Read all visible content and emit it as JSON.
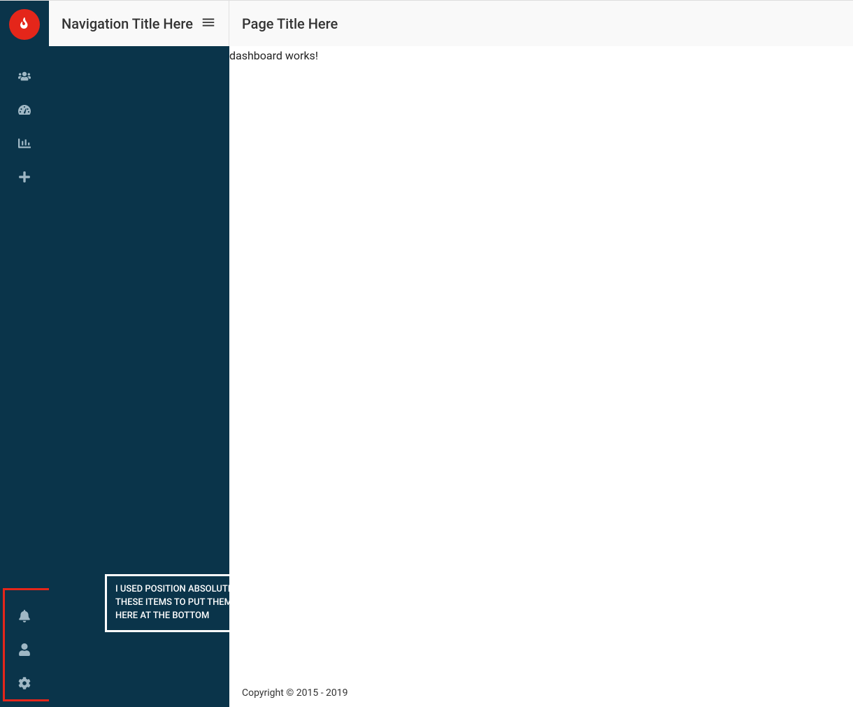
{
  "logo_icon": "fire-icon",
  "sidebar_top": [
    {
      "name": "users-icon"
    },
    {
      "name": "dashboard-icon"
    },
    {
      "name": "chart-icon"
    },
    {
      "name": "plus-icon"
    }
  ],
  "sidebar_bottom": [
    {
      "name": "bell-icon"
    },
    {
      "name": "user-icon"
    },
    {
      "name": "gear-icon"
    }
  ],
  "nav_title": "Navigation Title Here",
  "page_title": "Page Title Here",
  "body_text": "dashboard works!",
  "annotation": "I USED POSITION ABSOLUTE TO THESE ITEMS TO PUT THEM HERE AT THE BOTTOM",
  "footer": "Copyright © 2015 - 2019"
}
